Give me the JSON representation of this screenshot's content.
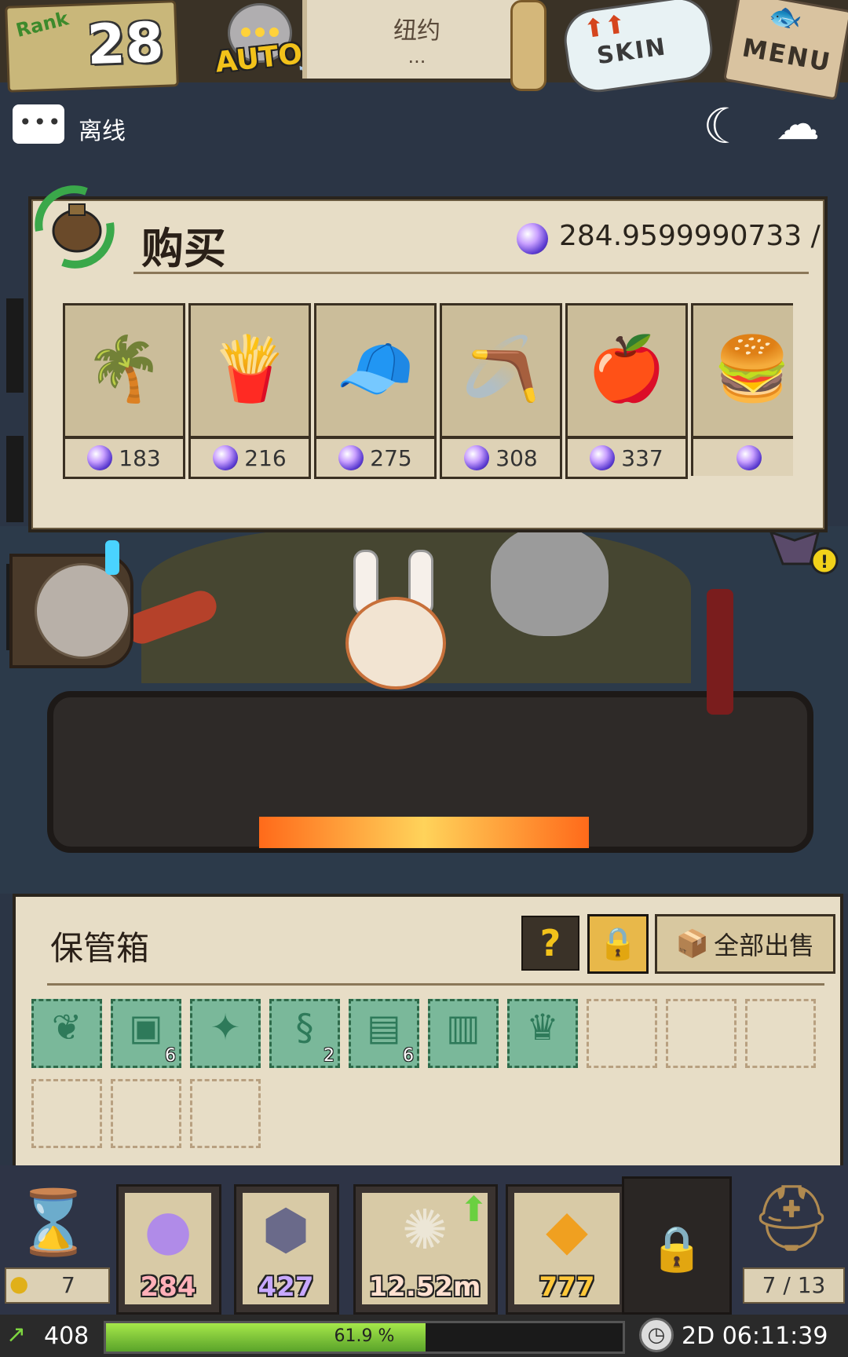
{
  "header": {
    "rank_label": "Rank",
    "rank_value": "28",
    "auto_label": "AUTO",
    "location_name": "纽约",
    "location_sub": "...",
    "skin_label": "SKIN",
    "menu_label": "MENU"
  },
  "chat": {
    "status": "离线"
  },
  "buy_panel": {
    "title": "购买",
    "balance": "284.9599990733 /",
    "items": [
      {
        "icon": "palm-tree",
        "glyph": "🌴",
        "price": "183"
      },
      {
        "icon": "french-fries",
        "glyph": "🍟",
        "price": "216"
      },
      {
        "icon": "cap",
        "glyph": "🧢",
        "price": "275"
      },
      {
        "icon": "boomerang",
        "glyph": "🪃",
        "price": "308"
      },
      {
        "icon": "apple-branch",
        "glyph": "🍎",
        "price": "337"
      },
      {
        "icon": "burger",
        "glyph": "🍔",
        "price": ""
      }
    ]
  },
  "storage": {
    "title": "保管箱",
    "help_label": "?",
    "sell_all_label": "全部出售",
    "slots": [
      {
        "state": "filled",
        "icon": "leaf",
        "glyph": "❦",
        "count": ""
      },
      {
        "state": "filled",
        "icon": "cube",
        "glyph": "▣",
        "count": "6"
      },
      {
        "state": "filled",
        "icon": "crystal",
        "glyph": "✦",
        "count": ""
      },
      {
        "state": "filled",
        "icon": "spring",
        "glyph": "§",
        "count": "2"
      },
      {
        "state": "filled",
        "icon": "cloth",
        "glyph": "▤",
        "count": "6"
      },
      {
        "state": "filled",
        "icon": "book",
        "glyph": "▥",
        "count": ""
      },
      {
        "state": "filled",
        "icon": "crown",
        "glyph": "♛",
        "count": ""
      },
      {
        "state": "empty"
      },
      {
        "state": "empty"
      },
      {
        "state": "empty"
      },
      {
        "state": "empty"
      },
      {
        "state": "empty"
      },
      {
        "state": "empty"
      }
    ]
  },
  "bottom_bar": {
    "potion_count": "7",
    "resources": [
      {
        "icon": "gem-orb",
        "glyph": "●",
        "value": "284",
        "color": "#ffb0b8",
        "icon_color": "#b08be8"
      },
      {
        "icon": "shield-emblem",
        "glyph": "⬢",
        "value": "427",
        "color": "#c8a8ff",
        "icon_color": "#6a6a8a"
      },
      {
        "icon": "spiral-gear",
        "glyph": "✺",
        "value": "12.52m",
        "color": "#ffe0d0",
        "icon_color": "#ece6d6"
      },
      {
        "icon": "gold-ore",
        "glyph": "◆",
        "value": "777",
        "color": "#ffc83a",
        "icon_color": "#f0a020"
      }
    ],
    "chest_count": "7 / 13"
  },
  "status_bar": {
    "level": "408",
    "xp_percent": 61.9,
    "xp_label": "61.9 %",
    "timer": "2D 06:11:39"
  },
  "colors": {
    "panel_bg": "#e7ddc6",
    "xp_green": "#7ed640",
    "accent_gold": "#f2c21a"
  }
}
